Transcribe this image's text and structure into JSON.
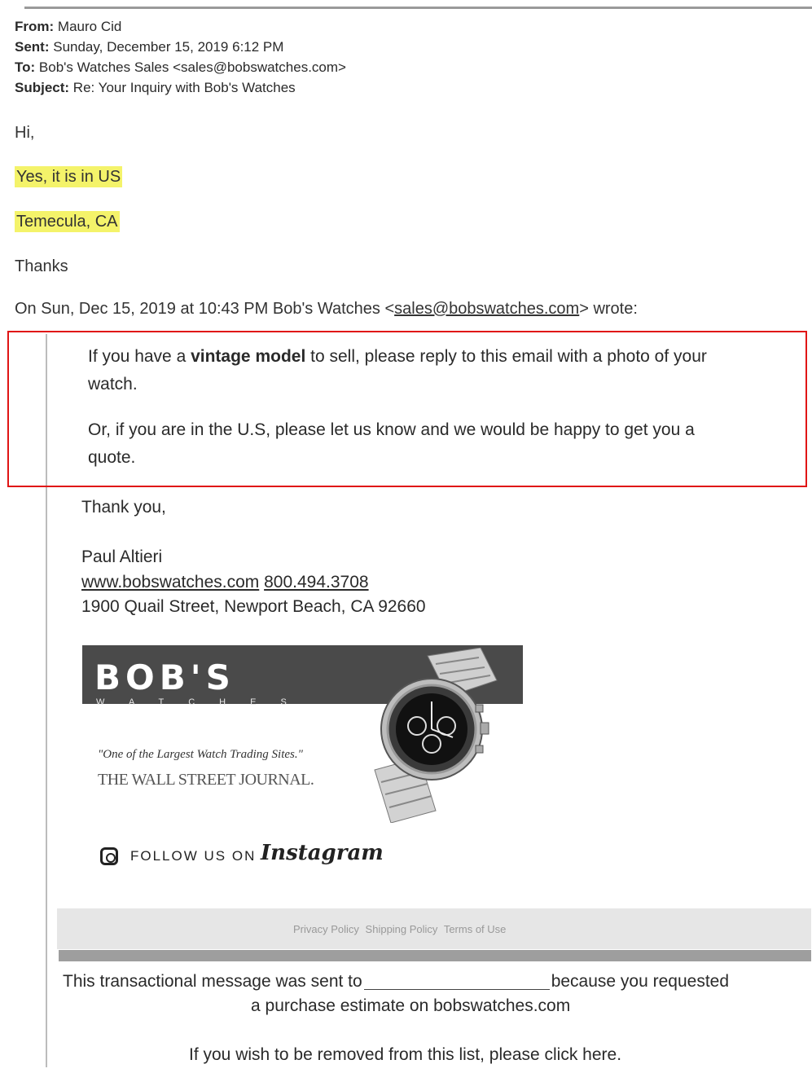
{
  "header": {
    "from_label": "From:",
    "from_value": "Mauro Cid",
    "sent_label": "Sent:",
    "sent_value": "Sunday, December 15, 2019 6:12 PM",
    "to_label": "To:",
    "to_value": "Bob's Watches Sales <sales@bobswatches.com>",
    "subject_label": "Subject:",
    "subject_value": "Re: Your Inquiry with Bob's Watches"
  },
  "reply": {
    "greeting": "Hi,",
    "line1": "Yes, it is in US",
    "line2": "Temecula, CA",
    "closing": "Thanks"
  },
  "quoted": {
    "attribution_pre": "On Sun, Dec 15, 2019 at 10:43 PM Bob's Watches <",
    "attribution_email": "sales@bobswatches.com",
    "attribution_post": "> wrote:",
    "p1_pre": "If you have a ",
    "p1_bold": "vintage model",
    "p1_post": " to sell, please reply to this email with a photo of your",
    "p1_line2": "watch.",
    "p2_line1": "Or, if you are in the U.S, please let us know and we would be happy to get you a",
    "p2_line2": "quote.",
    "thanks": "Thank you,",
    "sig_name": "Paul Altieri",
    "sig_site": "www.bobswatches.com",
    "sig_phone": "800.494.3708",
    "sig_address": "1900 Quail Street, Newport Beach, CA 92660"
  },
  "banner": {
    "brand": "BOB'S",
    "brand_sub": "WATCHES",
    "tagline": "\"One of the Largest Watch Trading Sites.\"",
    "source": "THE WALL STREET JOURNAL."
  },
  "social": {
    "follow": "FOLLOW US ON",
    "network": "Instagram",
    "icon": "instagram-icon"
  },
  "footer": {
    "links": [
      "Privacy Policy",
      "Shipping Policy",
      "Terms of Use"
    ],
    "notice_pre": "This transactional message was sent to",
    "notice_post": "because you requested",
    "notice_line2": "a purchase estimate on bobswatches.com",
    "unsubscribe": "If you wish to be removed from this list, please click here."
  },
  "colors": {
    "highlight": "#f4f36a",
    "annotation_box": "#e01515"
  }
}
